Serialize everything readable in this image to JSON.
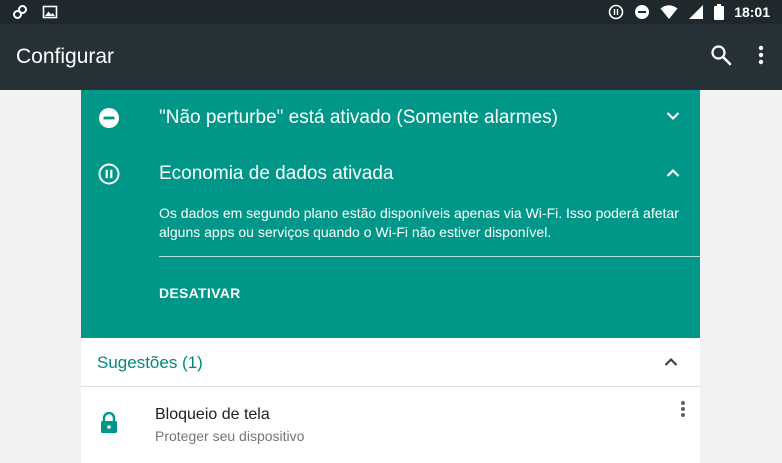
{
  "status_bar": {
    "time": "18:01",
    "icons": [
      "sync-link-icon",
      "image-icon",
      "data-saver-icon",
      "do-not-disturb-icon",
      "wifi-icon",
      "signal-icon",
      "battery-icon"
    ]
  },
  "app_bar": {
    "title": "Configurar",
    "icons": [
      "search-icon",
      "more-vert-icon"
    ]
  },
  "dnd_card": {
    "title": "\"Não perturbe\" está ativado (Somente alarmes)",
    "icon": "do-not-disturb-icon",
    "chevron": "chevron-down-icon"
  },
  "data_saver_card": {
    "title": "Economia de dados ativada",
    "description": "Os dados em segundo plano estão disponíveis apenas via Wi-Fi. Isso poderá afetar alguns apps ou serviços quando o Wi-Fi não estiver disponível.",
    "action": "DESATIVAR",
    "icon": "data-saver-icon",
    "chevron": "chevron-up-icon"
  },
  "suggestions": {
    "header": "Sugestões (1)",
    "items": [
      {
        "title": "Bloqueio de tela",
        "subtitle": "Proteger seu dispositivo",
        "icon": "lock-icon"
      }
    ]
  },
  "colors": {
    "teal": "#009688",
    "app_bar": "#263238",
    "status_bar": "#1e282d",
    "accent_text": "#00897b"
  }
}
